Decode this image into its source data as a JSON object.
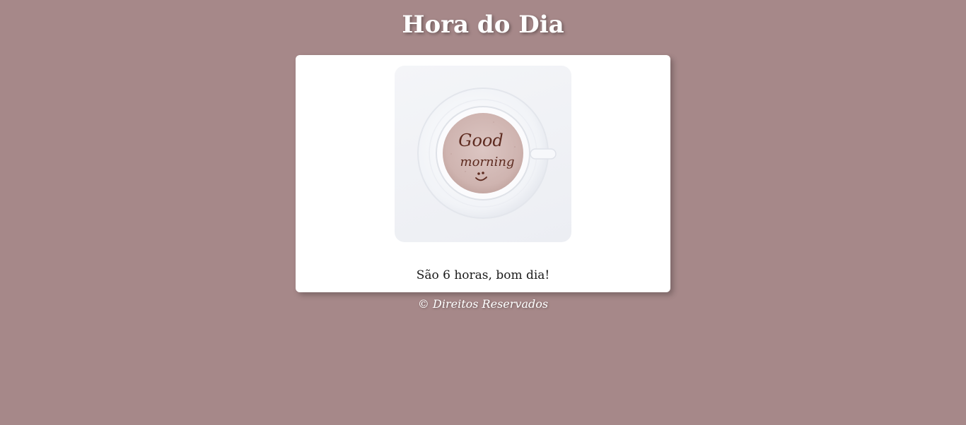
{
  "header": {
    "title": "Hora do Dia"
  },
  "card": {
    "image": {
      "subject": "coffee-cup",
      "latte_art_line1": "Good",
      "latte_art_line2": "morning"
    },
    "message": "São 6 horas, bom dia!"
  },
  "footer": {
    "copyright_symbol": "©",
    "text": "Direitos Reservados"
  },
  "colors": {
    "background": "#a68889",
    "card": "#ffffff",
    "title": "#ffffff"
  }
}
